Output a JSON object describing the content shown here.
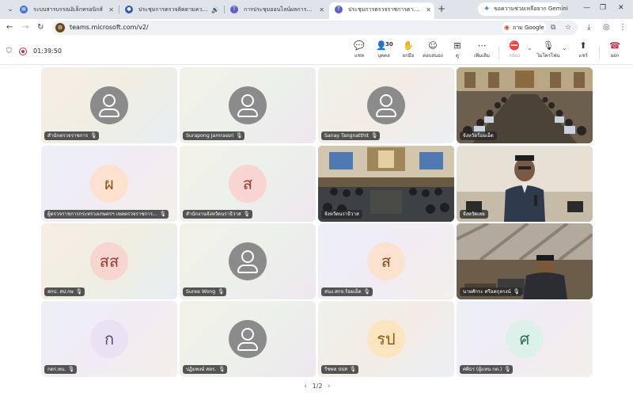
{
  "browser": {
    "tabs": [
      {
        "label": "ระบบสารบรรณอิเล็กทรอนิกส์",
        "favicon": "document-icon",
        "favicon_color": "#3a6fd8"
      },
      {
        "label": "ประชุมการตรวจติดตามความก้าวหน้า",
        "favicon": "meeting-logo-icon",
        "favicon_color": "#2f5bb7"
      },
      {
        "label": "การประชุมออนไลน์ผลการสนทนาฯ",
        "favicon": "teams-icon",
        "favicon_color": "#5b5fc7"
      },
      {
        "label": "ประชุมการตรวจราชการตามแผนฯ",
        "favicon": "teams-icon",
        "favicon_color": "#5b5fc7",
        "active": true
      }
    ],
    "gemini_label": "ขอความช่วยเหลือจาก Gemini",
    "url": "teams.microsoft.com/v2/",
    "translate_label": "ถาม Google"
  },
  "meeting": {
    "timer": "01:39:50",
    "toolbar": [
      {
        "label": "แชท",
        "icon": "chat-icon"
      },
      {
        "label": "บุคคล",
        "icon": "people-icon",
        "count": "30"
      },
      {
        "label": "ยกมือ",
        "icon": "raise-hand-icon"
      },
      {
        "label": "ตอบสนอง",
        "icon": "react-icon"
      },
      {
        "label": "ดู",
        "icon": "view-icon"
      },
      {
        "label": "เพิ่มเติม",
        "icon": "more-icon"
      },
      {
        "label": "กล้อง",
        "icon": "camera-off-icon",
        "disabled": true
      },
      {
        "label": "ไมโครโฟน",
        "icon": "mic-off-icon"
      },
      {
        "label": "แชร์",
        "icon": "share-icon"
      },
      {
        "label": "ออก",
        "icon": "hang-up-icon"
      }
    ],
    "accent": "#c4314b"
  },
  "participants": [
    {
      "name": "สำนักตรวจราชการ",
      "type": "generic",
      "muted": true
    },
    {
      "name": "Surapong Jamrassri",
      "type": "generic",
      "muted": true
    },
    {
      "name": "Sanay Tangnatthit",
      "type": "generic",
      "muted": true
    },
    {
      "name": "จังหวัดร้อยเอ็ด",
      "type": "video",
      "scene": "conference-room"
    },
    {
      "name": "ผู้ตรวจราชการกระทรวงเกษตรฯ เขตตรวจราชการ...",
      "type": "initials",
      "initials": "ผ",
      "muted": true
    },
    {
      "name": "สำนักงานจังหวัดนราธิวาส",
      "type": "initials",
      "initials": "ส",
      "muted": true
    },
    {
      "name": "จังหวัดนราธิวาส",
      "type": "video",
      "scene": "conference-hall"
    },
    {
      "name": "จังหวัดเลย",
      "type": "video",
      "scene": "speaker"
    },
    {
      "name": "สกป. สป.กษ",
      "type": "initials",
      "initials": "สส",
      "muted": true
    },
    {
      "name": "Suree Wong",
      "type": "generic",
      "muted": true
    },
    {
      "name": "สนง.สกจ.ร้อยเอ็ด",
      "type": "initials",
      "initials": "ส",
      "muted": true
    },
    {
      "name": "นายศักระ ศรีอดกุลรงน์",
      "type": "video",
      "scene": "office-speaker",
      "muted": true
    },
    {
      "name": "กตร.ทบ.",
      "type": "initials",
      "initials": "ก",
      "muted": true
    },
    {
      "name": "ปฏิมพงษ์ สตร.",
      "type": "generic",
      "muted": true
    },
    {
      "name": "ริชพล ปปส",
      "type": "initials",
      "initials": "รป",
      "muted": true
    },
    {
      "name": "ศศิธร (ผู้แทน กต.)",
      "type": "initials",
      "initials": "ศ",
      "muted": true
    }
  ],
  "pager": {
    "label": "1/2"
  }
}
